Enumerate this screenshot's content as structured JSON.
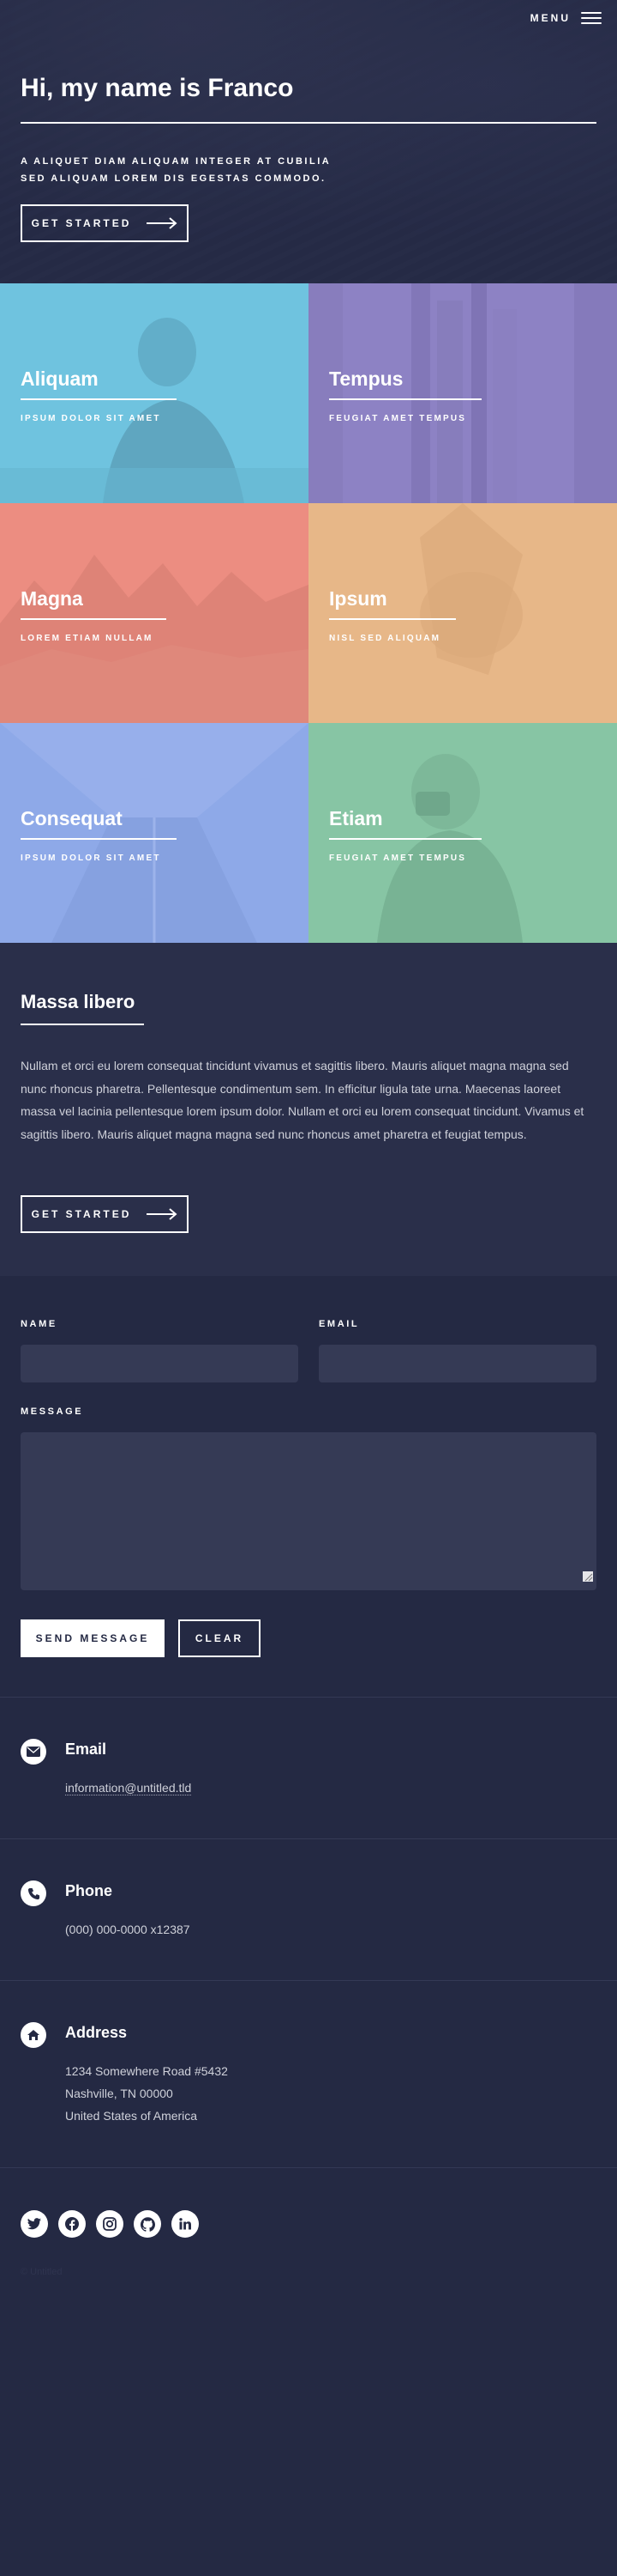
{
  "header": {
    "menu_label": "MENU",
    "title": "Hi, my name is Franco",
    "subtitle_lines": [
      "A ALIQUET DIAM ALIQUAM INTEGER AT CUBILIA",
      "SED ALIQUAM LOREM DIS EGESTAS COMMODO."
    ],
    "cta_label": "GET STARTED"
  },
  "tiles": [
    {
      "title": "Aliquam",
      "subtitle": "IPSUM DOLOR SIT AMET",
      "color": "#6fc3df"
    },
    {
      "title": "Tempus",
      "subtitle": "FEUGIAT AMET TEMPUS",
      "color": "#8d82c4"
    },
    {
      "title": "Magna",
      "subtitle": "LOREM ETIAM NULLAM",
      "color": "#ec8d81"
    },
    {
      "title": "Ipsum",
      "subtitle": "NISL SED ALIQUAM",
      "color": "#e7b788"
    },
    {
      "title": "Consequat",
      "subtitle": "IPSUM DOLOR SIT AMET",
      "color": "#8ea9e8"
    },
    {
      "title": "Etiam",
      "subtitle": "FEUGIAT AMET TEMPUS",
      "color": "#87c5a4"
    }
  ],
  "about": {
    "title": "Massa libero",
    "body": "Nullam et orci eu lorem consequat tincidunt vivamus et sagittis libero. Mauris aliquet magna magna sed nunc rhoncus pharetra. Pellentesque condimentum sem. In efficitur ligula tate urna. Maecenas laoreet massa vel lacinia pellentesque lorem ipsum dolor. Nullam et orci eu lorem consequat tincidunt. Vivamus et sagittis libero. Mauris aliquet magna magna sed nunc rhoncus amet pharetra et feugiat tempus.",
    "cta_label": "GET STARTED"
  },
  "form": {
    "name_label": "NAME",
    "email_label": "EMAIL",
    "message_label": "MESSAGE",
    "name_value": "",
    "email_value": "",
    "message_value": "",
    "send_label": "SEND MESSAGE",
    "clear_label": "CLEAR"
  },
  "contact": {
    "email": {
      "title": "Email",
      "value": "information@untitled.tld",
      "icon": "envelope-icon"
    },
    "phone": {
      "title": "Phone",
      "value": "(000) 000-0000 x12387",
      "icon": "phone-icon"
    },
    "address": {
      "title": "Address",
      "lines": [
        "1234 Somewhere Road #5432",
        "Nashville, TN 00000",
        "United States of America"
      ],
      "icon": "home-icon"
    }
  },
  "social": [
    "twitter-icon",
    "facebook-icon",
    "instagram-icon",
    "github-icon",
    "linkedin-icon"
  ],
  "footer": {
    "copyright": "© Untitled"
  },
  "colors": {
    "background": "#242943",
    "panel": "#2a2f4a",
    "field": "#353a55",
    "text_muted": "#cfd1da"
  }
}
